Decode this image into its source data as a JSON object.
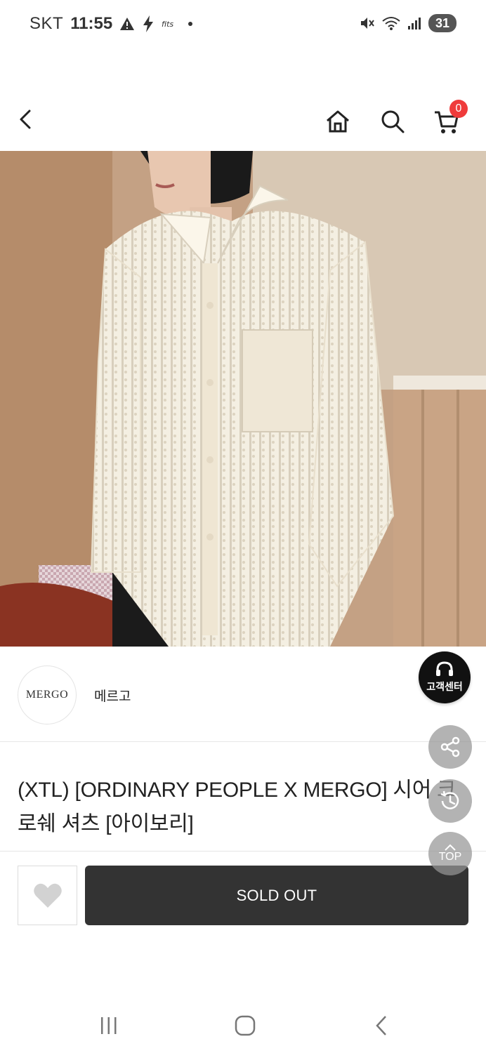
{
  "status_bar": {
    "carrier": "SKT",
    "time": "11:55",
    "battery": "31",
    "icons": [
      "warning-icon",
      "bolt-icon",
      "app-icon",
      "dot-icon",
      "mute-icon",
      "wifi-icon",
      "signal-icon"
    ]
  },
  "header": {
    "cart_count": "0",
    "icons": [
      "back-arrow-icon",
      "home-icon",
      "search-icon",
      "cart-icon"
    ]
  },
  "product_image": {
    "subject": "white crochet knit shirt on model"
  },
  "brand": {
    "logo_text": "MERGO",
    "name": "메르고"
  },
  "product": {
    "title": "(XTL) [ORDINARY PEOPLE X MERGO] 시어 크로쉐 셔츠 [아이보리]"
  },
  "actions": {
    "sold_out_label": "SOLD OUT",
    "wish_icon": "heart-icon"
  },
  "floating": {
    "customer_center_label": "고객센터",
    "top_label": "TOP",
    "icons": [
      "headset-icon",
      "share-icon",
      "history-icon",
      "arrow-up-icon"
    ]
  },
  "colors": {
    "accent_badge": "#ef3b3b",
    "sold_out_bg": "#333333",
    "customer_center_bg": "#111111"
  }
}
